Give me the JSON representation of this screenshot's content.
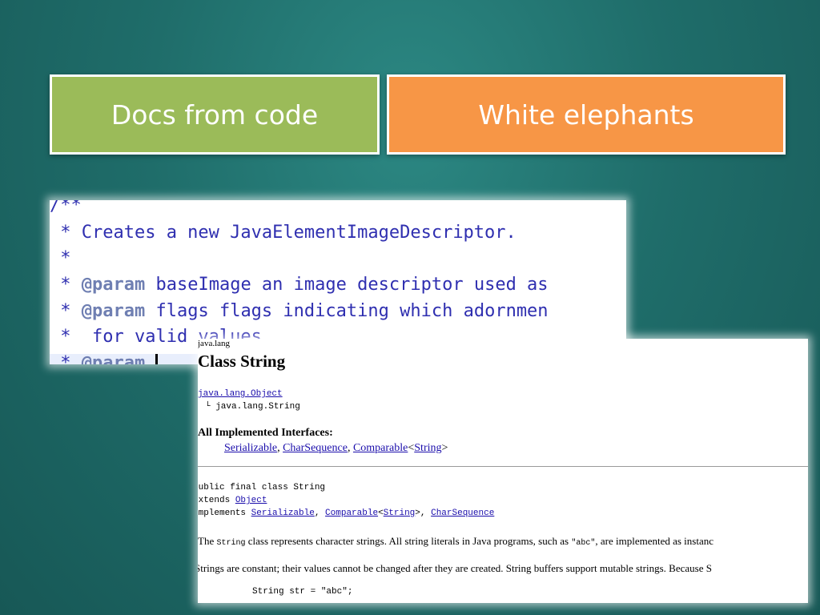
{
  "boxes": {
    "left": "Docs from code",
    "right": "White elephants"
  },
  "code": {
    "lines": [
      "/**",
      " * Creates a new JavaElementImageDescriptor.",
      " *",
      " * ",
      " * ",
      " *  for valid values.",
      " * "
    ],
    "param_tag": "@param",
    "param1_rest": " baseImage an image descriptor used as",
    "param2_rest": " flags flags indicating which adornmen",
    "param3_rest": " "
  },
  "doc": {
    "package": "java.lang",
    "class_title": "Class String",
    "superclass_link": "java.lang.Object",
    "tree_child": "└ java.lang.String",
    "interfaces_heading": "All Implemented Interfaces:",
    "interfaces": {
      "serializable": "Serializable",
      "sep1": ", ",
      "charsequence": "CharSequence",
      "sep2": ", ",
      "comparable": "Comparable",
      "lt": "<",
      "string": "String",
      "gt": ">"
    },
    "decl": {
      "line1": "public final class String",
      "extends_kw": "extends ",
      "extends_link": "Object",
      "implements_kw": "implements ",
      "impl_serializable": "Serializable",
      "comma1": ", ",
      "impl_comparable": "Comparable",
      "lt": "<",
      "impl_string": "String",
      "gt_comma": ">, ",
      "impl_charsequence": "CharSequence"
    },
    "para1": {
      "pre": "The ",
      "code": "String",
      "mid": " class represents character strings. All string literals in Java programs, such as ",
      "code2": "\"abc\"",
      "post": ", are implemented as instanc"
    },
    "para2": "Strings are constant; their values cannot be changed after they are created. String buffers support mutable strings. Because S",
    "code_sample": "String str = \"abc\";"
  }
}
